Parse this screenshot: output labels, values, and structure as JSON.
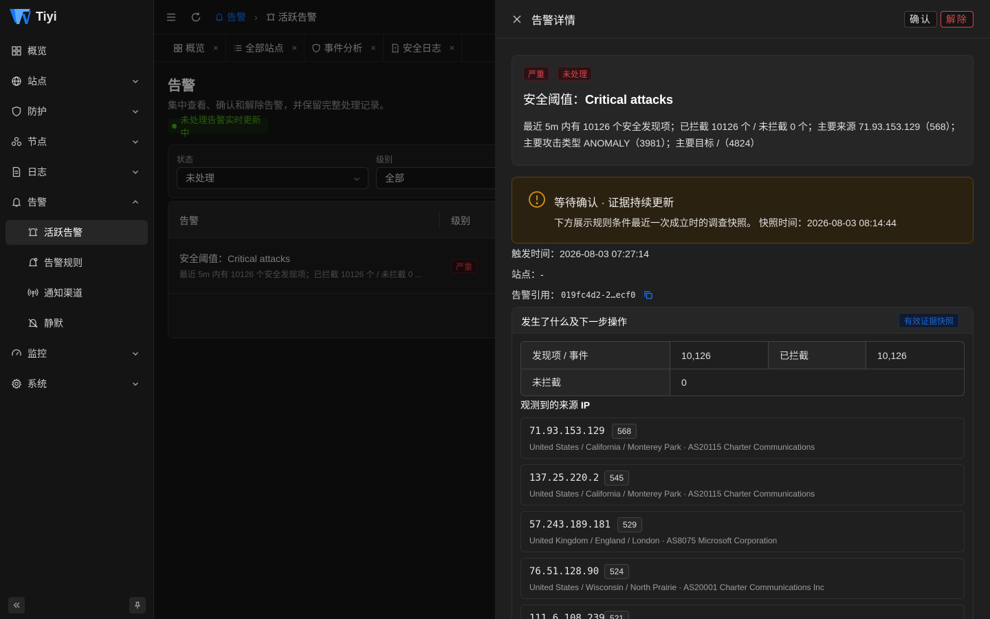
{
  "app": {
    "name": "Tiyi"
  },
  "sidebar": {
    "items": [
      {
        "label": "概览",
        "icon": "dashboard-icon"
      },
      {
        "label": "站点",
        "icon": "globe-icon"
      },
      {
        "label": "防护",
        "icon": "shield-icon"
      },
      {
        "label": "节点",
        "icon": "nodes-icon"
      },
      {
        "label": "日志",
        "icon": "file-icon"
      },
      {
        "label": "告警",
        "icon": "bell-icon"
      },
      {
        "label": "活跃告警",
        "icon": "bell-ring-icon"
      },
      {
        "label": "告警规则",
        "icon": "bell-rule-icon"
      },
      {
        "label": "通知渠道",
        "icon": "broadcast-icon"
      },
      {
        "label": "静默",
        "icon": "bell-off-icon"
      },
      {
        "label": "监控",
        "icon": "gauge-icon"
      },
      {
        "label": "系统",
        "icon": "gear-icon"
      }
    ]
  },
  "topbar": {
    "breadcrumb": [
      "告警",
      "活跃告警"
    ]
  },
  "tabs": [
    {
      "label": "概览",
      "close": "×"
    },
    {
      "label": "全部站点",
      "close": "×"
    },
    {
      "label": "事件分析",
      "close": "×"
    },
    {
      "label": "安全日志",
      "close": "×"
    }
  ],
  "page": {
    "title": "告警",
    "description": "集中查看、确认和解除告警，并保留完整处理记录。",
    "live_status": "未处理告警实时更新中"
  },
  "filters": {
    "status_label": "状态",
    "status_value": "未处理",
    "level_label": "级别",
    "level_value": "全部"
  },
  "table": {
    "headers": [
      "告警",
      "级别"
    ],
    "rows": [
      {
        "title": "安全阈值：Critical attacks",
        "desc": "最近 5m 内有 10126 个安全发现项；已拦截 10126 个 / 未拦截 0 ...",
        "level": "严重"
      }
    ]
  },
  "drawer": {
    "title": "告警详情",
    "confirm": "确认",
    "resolve": "解除",
    "tags": [
      "严重",
      "未处理"
    ],
    "rule_prefix": "安全阈值：",
    "rule_name": "Critical attacks",
    "summary_line1": "最近 5m 内有 10126 个安全发现项；已拦截 10126 个 / 未拦截 0 个；主要来源 71.93.153.129（568）；",
    "summary_line2": "主要攻击类型 ANOMALY（3981）；主要目标 /（4824）",
    "warn_title": "等待确认 · 证据持续更新",
    "warn_desc": "下方展示规则条件最近一次成立时的调查快照。 快照时间：2026-08-03 08:14:44",
    "triggered_label": "触发时间：",
    "triggered_value": "2026-08-03 07:27:14",
    "site_label": "站点：",
    "site_value": "-",
    "ref_label": "告警引用：",
    "ref_value": "019fc4d2-2…ecf0",
    "section_title": "发生了什么及下一步操作",
    "snapshot_tag": "有效证据快照",
    "stats": {
      "findings_label": "发现项 / 事件",
      "findings_value": "10,126",
      "blocked_label": "已拦截",
      "blocked_value": "10,126",
      "unblocked_label": "未拦截",
      "unblocked_value": "0"
    },
    "sources_prefix": "观测到的来源 ",
    "sources_suffix": "IP",
    "sources": [
      {
        "ip": "71.93.153.129",
        "count": "568",
        "geo": "United States / California / Monterey Park · AS20115 Charter Communications"
      },
      {
        "ip": "137.25.220.2",
        "count": "545",
        "geo": "United States / California / Monterey Park · AS20115 Charter Communications"
      },
      {
        "ip": "57.243.189.181",
        "count": "529",
        "geo": "United Kingdom / England / London · AS8075 Microsoft Corporation"
      },
      {
        "ip": "76.51.128.90",
        "count": "524",
        "geo": "United States / Wisconsin / North Prairie · AS20001 Charter Communications Inc"
      },
      {
        "ip": "111.6.108.239",
        "count": "521",
        "geo": ""
      }
    ]
  },
  "colors": {
    "accent": "#1677ff",
    "danger": "#dc4446",
    "warning": "#d89614",
    "success": "#49aa19"
  }
}
